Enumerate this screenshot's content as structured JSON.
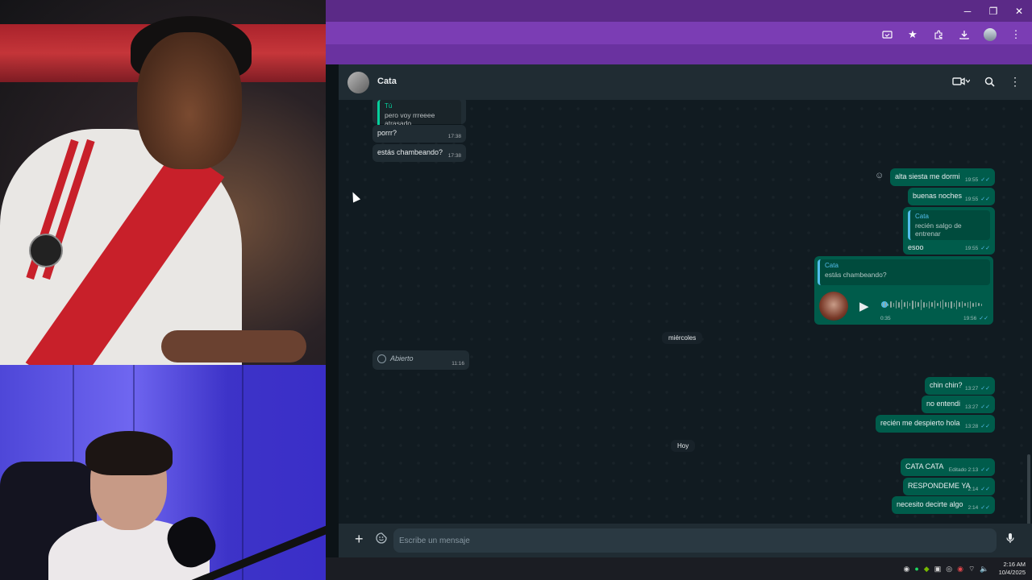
{
  "window": {
    "minimize_glyph": "─",
    "restore_glyph": "❐",
    "close_glyph": "✕"
  },
  "browser_toolbar": {
    "icons": [
      "cast-icon",
      "star-icon",
      "extensions-icon",
      "download-icon",
      "profile-avatar",
      "kebab-menu-icon"
    ]
  },
  "chat": {
    "contact_name": "Cata",
    "header_icons": [
      "video-call-icon",
      "chevron-down-icon",
      "search-icon",
      "kebab-menu-icon"
    ],
    "messages": [
      {
        "id": "m1",
        "dir": "in",
        "quote_author": "Tú",
        "quote_text": "pero voy rrreeee atrasado",
        "text": "",
        "time": ""
      },
      {
        "id": "m2",
        "dir": "in",
        "text": "porrr?",
        "time": "17:38"
      },
      {
        "id": "m3",
        "dir": "in",
        "text": "estás chambeando?",
        "time": "17:38"
      },
      {
        "id": "m4",
        "dir": "out",
        "text": "alta siesta me dormi",
        "time": "19:55"
      },
      {
        "id": "m5",
        "dir": "out",
        "text": "buenas noches",
        "time": "19:55"
      },
      {
        "id": "m6",
        "dir": "out",
        "quote_author": "Cata",
        "quote_text": "recién salgo de entrenar",
        "text": "esoo",
        "time": "19:55"
      },
      {
        "id": "m7",
        "dir": "out",
        "quote_author": "Cata",
        "quote_text": "estás chambeando?",
        "voice_duration": "0:35",
        "time": "19:56"
      },
      {
        "id": "m8",
        "dir": "in",
        "text": "Abierto",
        "time": "11:16"
      },
      {
        "id": "m9",
        "dir": "out",
        "text": "chin chin?",
        "time": "13:27"
      },
      {
        "id": "m10",
        "dir": "out",
        "text": "no entendi",
        "time": "13:27"
      },
      {
        "id": "m11",
        "dir": "out",
        "text": "recién me despierto hola",
        "time": "13:28"
      },
      {
        "id": "m12",
        "dir": "out",
        "text": "CATA CATA",
        "edited": "Editado",
        "time": "2:13"
      },
      {
        "id": "m13",
        "dir": "out",
        "text": "RESPONDEME YA",
        "time": "2:14"
      },
      {
        "id": "m14",
        "dir": "out",
        "text": "necesito decirte algo",
        "time": "2:14"
      }
    ],
    "day_separators": {
      "wednesday": "miércoles",
      "today": "Hoy"
    },
    "composer": {
      "placeholder": "Escribe un mensaje"
    }
  },
  "taskbar": {
    "tray_icons": [
      "discord-icon",
      "spotify-icon",
      "nvidia-icon",
      "network-icon",
      "steam-icon",
      "app-icon",
      "wifi-icon",
      "volume-icon"
    ],
    "time": "2:16 AM",
    "date": "10/4/2025"
  },
  "colors": {
    "browser_frame": "#6a32a0",
    "chat_bg": "#111b21",
    "outgoing_bubble": "#005c4b",
    "incoming_bubble": "#202c33",
    "read_check": "#53bdeb"
  }
}
